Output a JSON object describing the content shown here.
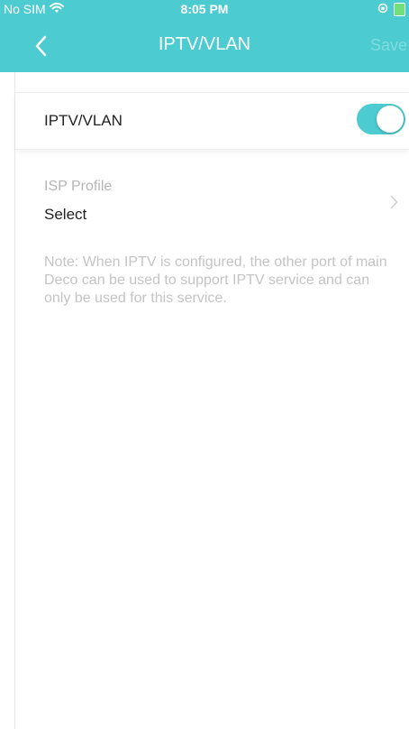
{
  "status_bar": {
    "carrier": "No SIM",
    "time": "8:05 PM",
    "wifi_icon": "wifi-icon",
    "lock_icon": "orientation-lock-icon",
    "battery_icon": "battery-charging-icon"
  },
  "nav": {
    "back_icon": "chevron-left-icon",
    "title": "IPTV/VLAN",
    "save_label": "Save"
  },
  "toggle_row": {
    "label": "IPTV/VLAN",
    "enabled": true
  },
  "isp_profile": {
    "label": "ISP Profile",
    "value": "Select",
    "chevron_icon": "chevron-right-icon"
  },
  "note": "Note: When IPTV is configured, the other port of main Deco can be used to support IPTV service and can only be used for this service.",
  "colors": {
    "accent": "#4ccbd0",
    "save_disabled": "#7fdce0",
    "muted_text": "#c4c4c4",
    "label_gray": "#b5b5b5",
    "text": "#222222"
  }
}
